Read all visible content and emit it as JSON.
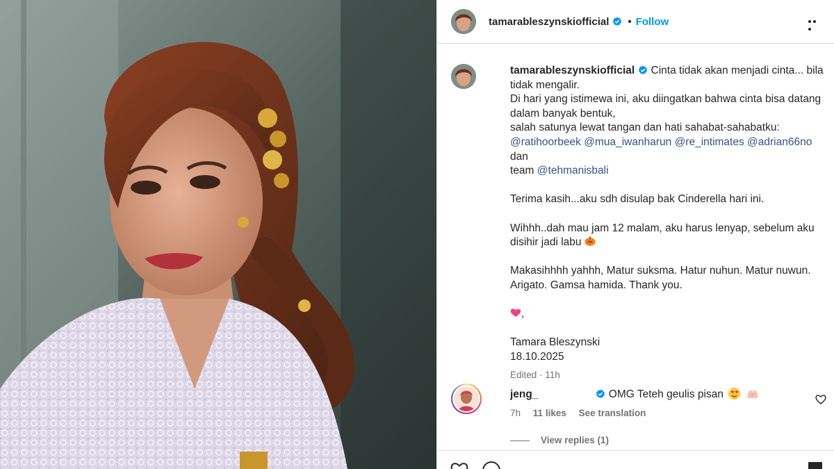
{
  "post": {
    "author": {
      "username": "tamarableszynskiofficial",
      "verified": true,
      "follow_label": "Follow",
      "separator": "•"
    },
    "caption": {
      "username": "tamarableszynskiofficial",
      "lines": [
        "Cinta tidak akan menjadi cinta... bila",
        "tidak mengalir.",
        "Di hari yang istimewa ini, aku diingatkan bahwa cinta bisa datang",
        "dalam banyak bentuk,",
        "salah satunya lewat tangan dan hati sahabat-sahabatku:"
      ],
      "mentions": [
        "@ratihoorbeek",
        "@mua_iwanharun",
        "@re_intimates",
        "@adrian66no"
      ],
      "mentions_joiner": "dan",
      "team_prefix": "team",
      "team_mention": "@tehmanisbali",
      "paragraph_2": "Terima kasih...aku sdh disulap bak Cinderella hari ini.",
      "paragraph_3_line1": "Wihhh..dah mau jam 12 malam, aku harus lenyap, sebelum aku",
      "paragraph_3_line2": "disihir jadi labu",
      "paragraph_3_emoji": "pumpkin-emoji",
      "paragraph_4_line1": "Makasihhhh yahhh, Matur suksma. Hatur nuhun. Matur nuwun.",
      "paragraph_4_line2": "Arigato. Gamsa hamida. Thank you.",
      "heart_suffix": ",",
      "signature_name": "Tamara Bleszynski",
      "signature_date": "18.10.2025",
      "edited_label": "Edited",
      "edited_dot": "·",
      "edited_time": "11h"
    },
    "comment": {
      "username": "jeng_",
      "verified": true,
      "text": "OMG Teteh geulis pisan",
      "time": "7h",
      "likes": "11 likes",
      "see_translation": "See translation",
      "view_replies": "View replies (1)"
    },
    "icons": {
      "more": "more-options-icon",
      "verified": "verified-badge-icon",
      "like": "heart-icon",
      "comment": "comment-icon",
      "save": "bookmark-icon"
    },
    "colors": {
      "link": "#0095f6",
      "mention": "#385185",
      "muted": "#737373",
      "text": "#262626"
    }
  }
}
